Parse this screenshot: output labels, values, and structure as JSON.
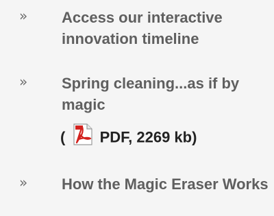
{
  "links": [
    {
      "bullet": "»",
      "label": "Access our interactive innovation timeline"
    },
    {
      "bullet": "»",
      "label": "Spring cleaning...as if by magic"
    },
    {
      "bullet": "»",
      "label": "How the Magic Eraser Works"
    }
  ],
  "attachment": {
    "open_paren": "(",
    "text": "PDF, 2269 kb)",
    "icon": "pdf-icon"
  },
  "colors": {
    "link_text": "#5f5f5f",
    "bullet": "#6b6b6b",
    "pdf_red": "#d3221e",
    "background": "#f5f5f5"
  }
}
